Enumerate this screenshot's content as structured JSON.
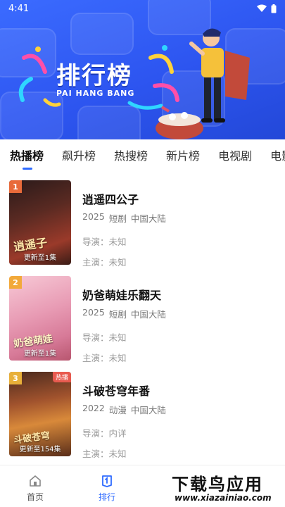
{
  "status_bar": {
    "time": "4:41"
  },
  "banner": {
    "title": "排行榜",
    "subtitle": "PAI HANG BANG",
    "colors": {
      "bg": "#2d55f0"
    }
  },
  "tabs": [
    {
      "label": "热播榜",
      "active": true
    },
    {
      "label": "飙升榜",
      "active": false
    },
    {
      "label": "热搜榜",
      "active": false
    },
    {
      "label": "新片榜",
      "active": false
    },
    {
      "label": "电视剧",
      "active": false
    },
    {
      "label": "电影",
      "active": false
    }
  ],
  "items": [
    {
      "rank": "1",
      "rank_color": "#e86a3a",
      "title": "逍遥四公子",
      "year": "2025",
      "genre": "短剧",
      "region": "中国大陆",
      "director": "导演：未知",
      "actors": "主演：未知",
      "update": "更新至1集",
      "art_title": "逍遥子",
      "badge": ""
    },
    {
      "rank": "2",
      "rank_color": "#f2a93a",
      "title": "奶爸萌娃乐翻天",
      "year": "2025",
      "genre": "短剧",
      "region": "中国大陆",
      "director": "导演：未知",
      "actors": "主演：未知",
      "update": "更新至1集",
      "art_title": "奶爸萌娃",
      "badge": ""
    },
    {
      "rank": "3",
      "rank_color": "#e8b03a",
      "title": "斗破苍穹年番",
      "year": "2022",
      "genre": "动漫",
      "region": "中国大陆",
      "director": "导演：内详",
      "actors": "主演：未知",
      "update": "更新至154集",
      "art_title": "斗破苍穹",
      "badge": "热播"
    }
  ],
  "bottom_nav": [
    {
      "label": "首页",
      "icon": "home-icon",
      "active": false
    },
    {
      "label": "排行",
      "icon": "rank-icon",
      "active": true
    }
  ],
  "watermark": {
    "title": "下载鸟应用",
    "url": "www.xiazainiao.com"
  }
}
